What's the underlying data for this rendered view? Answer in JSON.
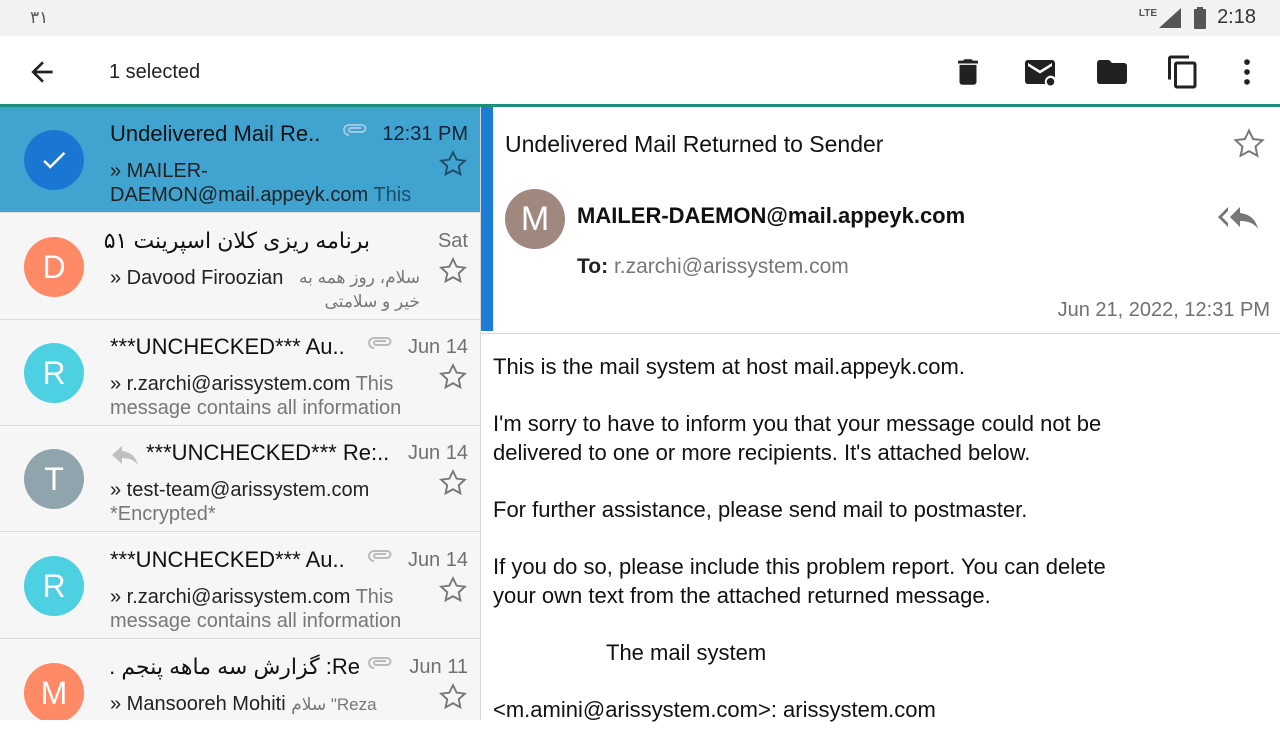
{
  "status": {
    "left": "۳۱",
    "net": "LTE",
    "time": "2:18"
  },
  "toolbar": {
    "title": "1 selected",
    "icons": [
      "back-arrow-icon",
      "trash-icon",
      "mark-unread-icon",
      "folder-icon",
      "copy-icon",
      "more-vert-icon"
    ]
  },
  "messages": [
    {
      "initial": "",
      "color": "#1976d2",
      "subject": "Undelivered Mail Re..",
      "date": "12:31 PM",
      "sender": "» MAILER-DAEMON@mail.appeyk.com",
      "snippet": "This is the mail system at",
      "attachment": true,
      "selected": true
    },
    {
      "initial": "D",
      "color": "#ff8a65",
      "subject": "برنامه ریزی کلان اسپرینت ۵۱",
      "date": "Sat",
      "sender": "» Davood Firoozian",
      "snippet": "سلام، روز همه به خیر و سلامتی برنامه ریزی این اسپرینت",
      "attachment": false,
      "selected": false
    },
    {
      "initial": "R",
      "color": "#4dd0e1",
      "subject": "***UNCHECKED*** Au..",
      "date": "Jun 14",
      "sender": "» r.zarchi@arissystem.com",
      "snippet": "This message contains all information",
      "attachment": true,
      "selected": false
    },
    {
      "initial": "T",
      "color": "#90a4ae",
      "subject": "***UNCHECKED*** Re:..",
      "date": "Jun 14",
      "sender": "» test-team@arissystem.com",
      "snippet": "*Encrypted*",
      "attachment": false,
      "replied": true,
      "selected": false
    },
    {
      "initial": "R",
      "color": "#4dd0e1",
      "subject": "***UNCHECKED*** Au..",
      "date": "Jun 14",
      "sender": "» r.zarchi@arissystem.com",
      "snippet": "This message contains all information",
      "attachment": true,
      "selected": false
    },
    {
      "initial": "M",
      "color": "#ff8a65",
      "subject": "Re: گزارش سه ماهه پنجم ..",
      "date": "Jun 11",
      "sender": "» Mansooreh Mohiti",
      "snippet": "سلام \"Reza Zarchi\" پیش",
      "attachment": true,
      "selected": false
    }
  ],
  "reader": {
    "subject": "Undelivered Mail Returned to Sender",
    "avatar_initial": "M",
    "sender": "MAILER-DAEMON@mail.appeyk.com",
    "to_label": "To:",
    "to_value": "r.zarchi@arissystem.com",
    "date": "Jun 21, 2022, 12:31 PM",
    "body": {
      "p1": "This is the mail system at host mail.appeyk.com.",
      "p2": "I'm sorry to have to inform you that your message could not be delivered to one or more recipients. It's attached below.",
      "p3": "For further assistance, please send mail to postmaster.",
      "p4": "If you do so, please include this problem report. You can delete your own text from the attached returned message.",
      "p5": "The mail system",
      "p6": "<m.amini@arissystem.com>: arissystem.com"
    }
  },
  "colors": {
    "accent": "#1a8f7f",
    "selected_row": "#41a3cf",
    "reader_bar": "#1e7bd6"
  }
}
